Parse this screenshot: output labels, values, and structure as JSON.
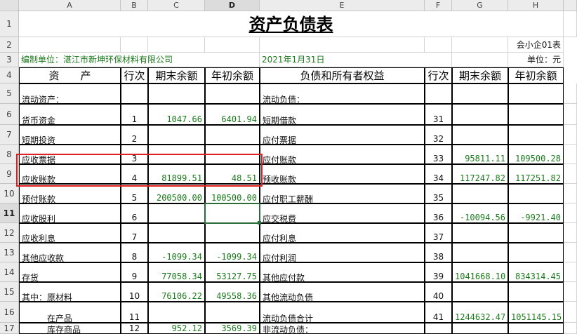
{
  "columns": [
    "A",
    "B",
    "C",
    "D",
    "E",
    "F",
    "G",
    "H"
  ],
  "selected_column": "D",
  "rows": [
    "1",
    "2",
    "3",
    "4",
    "5",
    "6",
    "7",
    "8",
    "9",
    "10",
    "11",
    "12",
    "13",
    "14",
    "15",
    "16",
    "17"
  ],
  "selected_row": "11",
  "title": "资产负债表",
  "form_code": "会小企01表",
  "unit_label": "编制单位：湛江市新坤环保材料有限公司",
  "report_date": "2021年1月31日",
  "currency_unit": "单位：元",
  "headers": {
    "asset": "资　　产",
    "line_no": "行次",
    "end_balance": "期末余额",
    "begin_balance": "年初余额",
    "liab": "负债和所有者权益",
    "line_no2": "行次",
    "end_balance2": "期末余额",
    "begin_balance2": "年初余额"
  },
  "table": [
    {
      "row": "5",
      "a": "流动资产：",
      "b": "",
      "c": "",
      "d": "",
      "e": "流动负债：",
      "f": "",
      "g": "",
      "h": ""
    },
    {
      "row": "6",
      "a": "货币资金",
      "b": "1",
      "c": "1047.66",
      "d": "6401.94",
      "e": "短期借款",
      "f": "31",
      "g": "",
      "h": ""
    },
    {
      "row": "7",
      "a": "短期投资",
      "b": "2",
      "c": "",
      "d": "",
      "e": "应付票据",
      "f": "32",
      "g": "",
      "h": ""
    },
    {
      "row": "8",
      "a": "应收票据",
      "b": "3",
      "c": "",
      "d": "",
      "e": "应付账款",
      "f": "33",
      "g": "95811.11",
      "h": "109500.28"
    },
    {
      "row": "9",
      "a": "应收账款",
      "b": "4",
      "c": "81899.51",
      "d": "48.51",
      "e": "预收账款",
      "f": "34",
      "g": "117247.82",
      "h": "117251.82"
    },
    {
      "row": "10",
      "a": "预付账款",
      "b": "5",
      "c": "200500.00",
      "d": "100500.00",
      "e": "应付职工薪酬",
      "f": "35",
      "g": "",
      "h": ""
    },
    {
      "row": "11",
      "a": "应收股利",
      "b": "6",
      "c": "",
      "d": "",
      "e": "应交税费",
      "f": "36",
      "g": "-10094.56",
      "h": "-9921.40"
    },
    {
      "row": "12",
      "a": "应收利息",
      "b": "7",
      "c": "",
      "d": "",
      "e": "应付利息",
      "f": "37",
      "g": "",
      "h": ""
    },
    {
      "row": "13",
      "a": "其他应收款",
      "b": "8",
      "c": "-1099.34",
      "d": "-1099.34",
      "e": "应付利润",
      "f": "38",
      "g": "",
      "h": ""
    },
    {
      "row": "14",
      "a": "存货",
      "b": "9",
      "c": "77058.34",
      "d": "53127.75",
      "e": "其他应付款",
      "f": "39",
      "g": "1041668.10",
      "h": "834314.45"
    },
    {
      "row": "15",
      "a": "其中：原材料",
      "b": "10",
      "c": "76106.22",
      "d": "49558.36",
      "e": "其他流动负债",
      "f": "40",
      "g": "",
      "h": ""
    },
    {
      "row": "16",
      "a": "　　　在产品",
      "b": "11",
      "c": "",
      "d": "",
      "e": "流动负债合计",
      "f": "41",
      "g": "1244632.47",
      "h": "1051145.15"
    },
    {
      "row": "17",
      "a": "　　　库存商品",
      "b": "12",
      "c": "952.12",
      "d": "3569.39",
      "e": "非流动负债：",
      "f": "",
      "g": "",
      "h": ""
    }
  ]
}
